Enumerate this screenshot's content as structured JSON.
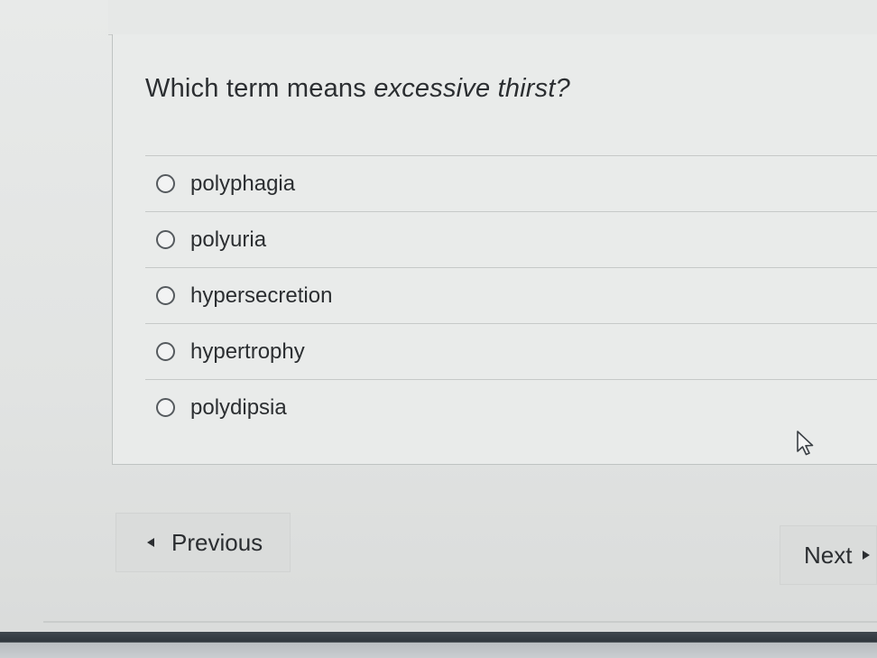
{
  "question": {
    "prefix": "Which term means ",
    "emphasis": "excessive thirst?"
  },
  "options": [
    {
      "label": "polyphagia",
      "selected": false
    },
    {
      "label": "polyuria",
      "selected": false
    },
    {
      "label": "hypersecretion",
      "selected": false
    },
    {
      "label": "hypertrophy",
      "selected": false
    },
    {
      "label": "polydipsia",
      "selected": false
    }
  ],
  "navigation": {
    "previous_label": "Previous",
    "next_label": "Next"
  },
  "icons": {
    "radio": "radio-unchecked-icon",
    "cursor": "mouse-pointer-icon",
    "prev_arrow": "triangle-left-icon",
    "next_arrow": "triangle-right-icon"
  },
  "colors": {
    "background": "#e3e5e4",
    "text": "#2b2e31",
    "button": "#dadcdb"
  }
}
